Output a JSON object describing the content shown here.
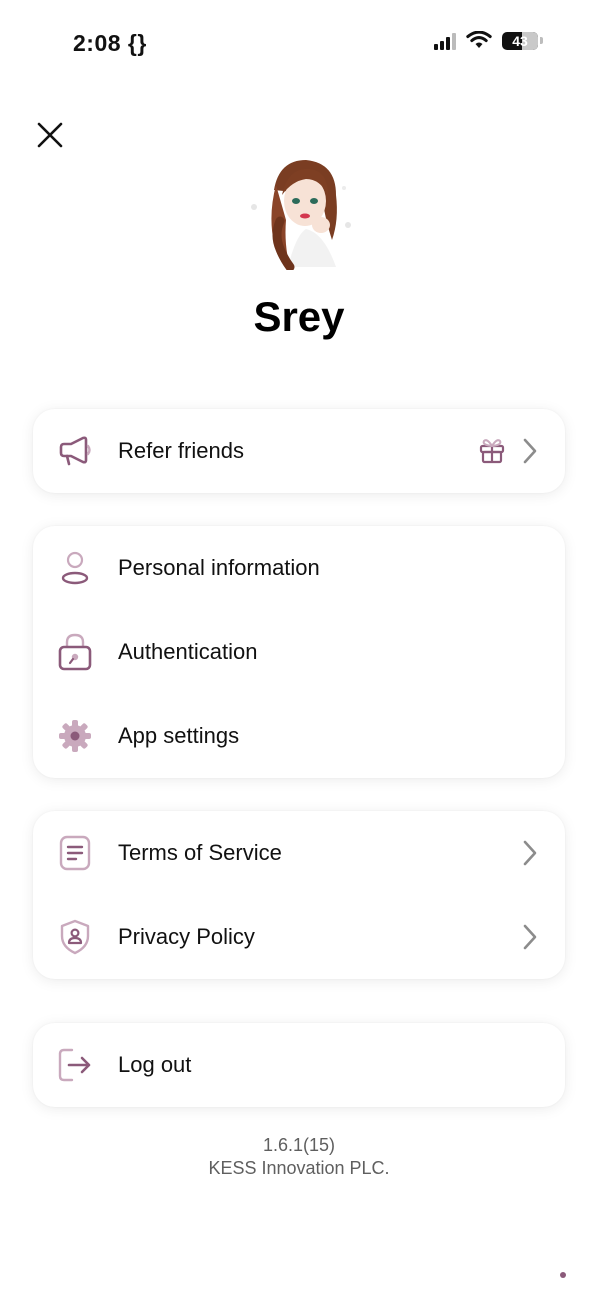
{
  "status_bar": {
    "time": "2:08 {}",
    "battery": "43"
  },
  "profile": {
    "name": "Srey"
  },
  "menu": {
    "refer_friends": "Refer friends",
    "personal_information": "Personal information",
    "authentication": "Authentication",
    "app_settings": "App settings",
    "terms_of_service": "Terms of Service",
    "privacy_policy": "Privacy Policy",
    "log_out": "Log out"
  },
  "footer": {
    "version": "1.6.1(15)",
    "company": "KESS Innovation PLC."
  },
  "icons": [
    "megaphone-icon",
    "gift-icon",
    "chevron-right-icon",
    "person-icon",
    "lock-icon",
    "gear-icon",
    "document-icon",
    "shield-icon",
    "logout-icon",
    "close-icon",
    "signal-icon",
    "wifi-icon",
    "battery-icon"
  ],
  "colors": {
    "accent": "#8b5a7a",
    "accent_light": "#c9a9bd"
  }
}
